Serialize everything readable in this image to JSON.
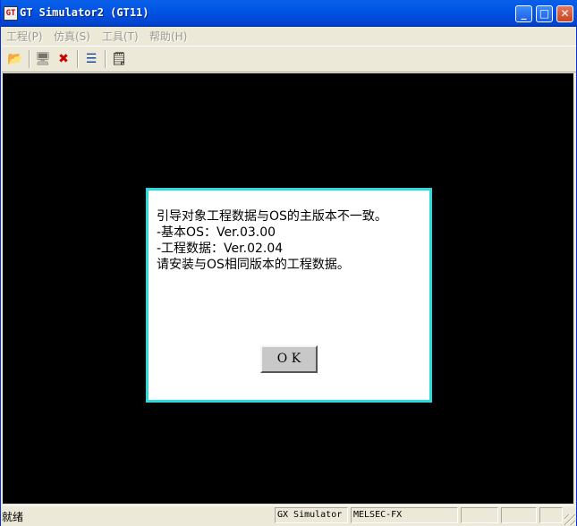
{
  "window": {
    "title": "GT Simulator2 (GT11)",
    "controls": {
      "minimize": "_",
      "maximize": "□",
      "close": "✕"
    }
  },
  "menu": [
    {
      "label": "工程(P)"
    },
    {
      "label": "仿真(S)"
    },
    {
      "label": "工具(T)"
    },
    {
      "label": "帮助(H)"
    }
  ],
  "toolbar": [
    {
      "icon": "open-folder-icon",
      "glyph": "📂"
    },
    {
      "icon": "communication-icon",
      "glyph": "🖥"
    },
    {
      "icon": "stop-simulation-icon",
      "glyph": "✖"
    },
    {
      "icon": "device-monitor-icon",
      "glyph": "☰"
    },
    {
      "icon": "options-icon",
      "glyph": "🗒"
    }
  ],
  "dialog": {
    "lines": [
      "引导对象工程数据与OS的主版本不一致。",
      "-基本OS：Ver.03.00",
      "-工程数据：Ver.02.04",
      "请安装与OS相同版本的工程数据。"
    ],
    "ok_label": "O K",
    "border_color": "#2cdcdc"
  },
  "status": {
    "main": "就绪",
    "panes": [
      "GX Simulator",
      "MELSEC-FX",
      "",
      "",
      ""
    ]
  },
  "colors": {
    "titlebar": "#0055e5",
    "screen_bg": "#000000",
    "dialog_bg": "#ffffff"
  }
}
